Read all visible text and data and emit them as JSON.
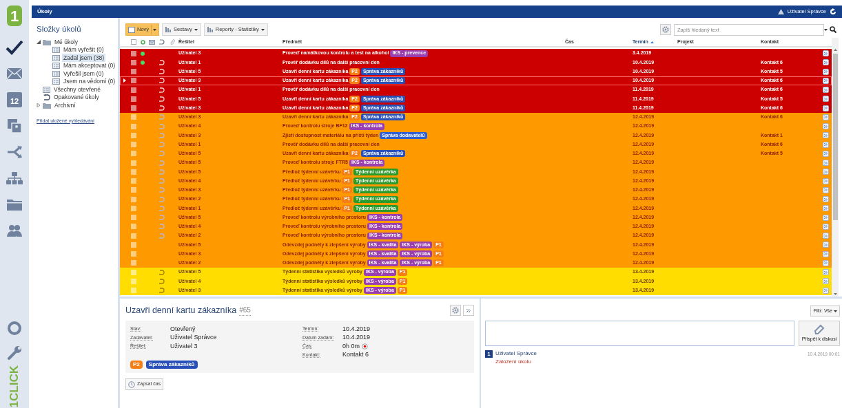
{
  "rail": {
    "logo": "1",
    "items": [
      {
        "kind": "tasks",
        "selected": true
      },
      {
        "kind": "mail",
        "selected": false
      },
      {
        "kind": "calendar",
        "text": "12",
        "selected": false
      },
      {
        "kind": "cards",
        "selected": false
      },
      {
        "kind": "share",
        "selected": false
      },
      {
        "kind": "org",
        "selected": false
      },
      {
        "kind": "folder",
        "selected": false
      },
      {
        "kind": "people",
        "selected": false
      }
    ],
    "bottom": [
      {
        "kind": "help"
      },
      {
        "kind": "wrench"
      }
    ],
    "brand": "1CLICK"
  },
  "topbar": {
    "title": "Úkoly",
    "user": "Uživatel Správce"
  },
  "folders": {
    "title": "Složky úkolů",
    "tree": [
      {
        "label": "Mé úkoly",
        "kind": "folder",
        "expanded": true,
        "selected": false,
        "children": [
          {
            "label": "Mám vyřešit (0)",
            "kind": "list",
            "selected": false
          },
          {
            "label": "Zadal jsem (38)",
            "kind": "list",
            "selected": true
          },
          {
            "label": "Mám akceptovat (0)",
            "kind": "list",
            "selected": false
          },
          {
            "label": "Vyřešil jsem (0)",
            "kind": "list",
            "selected": false
          },
          {
            "label": "Jsem na vědomí (0)",
            "kind": "list",
            "selected": false
          }
        ]
      },
      {
        "label": "Všechny otevřené",
        "kind": "list",
        "selected": false
      },
      {
        "label": "Opakované úkoly",
        "kind": "recurring",
        "selected": false
      },
      {
        "label": "Archivní",
        "kind": "folder",
        "expanded": false,
        "selected": false
      }
    ],
    "link": "Přidat uložené vyhledávání"
  },
  "toolbar": {
    "buttons": [
      {
        "label": "Nový",
        "kind": "split",
        "highlighted": true
      },
      {
        "label": "Sestavy",
        "kind": "menu",
        "highlighted": false
      },
      {
        "label": "Reporty - Statistiky",
        "kind": "menu",
        "highlighted": false
      }
    ],
    "search": {
      "placeholder": "Zapiš hledaný text"
    }
  },
  "table": {
    "all_checked": false,
    "columns": [
      {
        "label": "Řešitel",
        "sorted": false
      },
      {
        "label": "Předmět",
        "sorted": false
      },
      {
        "label": "Čas",
        "sorted": false
      },
      {
        "label": "Termín",
        "sorted": true
      },
      {
        "label": "Projekt",
        "sorted": false
      },
      {
        "label": "Kontakt",
        "sorted": false
      }
    ],
    "rows": [
      {
        "kind": "overdue",
        "selected": false,
        "checked": false,
        "unread": true,
        "recurring": false,
        "assignee": "Uživatel 3",
        "subject": "Proveď namátkovou kontrolu a test na alkohol",
        "tags": [
          {
            "text": "IKS - prevence",
            "color": "#9b3fb0"
          }
        ],
        "deadline": "3.4.2019"
      },
      {
        "kind": "overdue",
        "selected": false,
        "checked": false,
        "unread": true,
        "recurring": true,
        "assignee": "Uživatel 1",
        "subject": "Prověř dodávku dílů na další pracovní den",
        "deadline": "10.4.2019",
        "contact": "Kontakt 6"
      },
      {
        "kind": "overdue",
        "selected": false,
        "checked": false,
        "unread": false,
        "recurring": true,
        "assignee": "Uživatel 5",
        "subject": "Uzavři denní kartu zákazníka",
        "tags": [
          {
            "text": "P2",
            "color": "#f57f17"
          },
          {
            "text": "Správa zákazníků",
            "color": "#2850b8"
          }
        ],
        "deadline": "10.4.2019",
        "contact": "Kontakt 5"
      },
      {
        "kind": "overdue",
        "selected": true,
        "checked": false,
        "unread": false,
        "recurring": true,
        "assignee": "Uživatel 3",
        "subject": "Uzavři denní kartu zákazníka",
        "tags": [
          {
            "text": "P2",
            "color": "#f57f17"
          },
          {
            "text": "Správa zákazníků",
            "color": "#2850b8"
          }
        ],
        "deadline": "10.4.2019",
        "contact": "Kontakt 6"
      },
      {
        "kind": "overdue",
        "selected": false,
        "checked": false,
        "unread": false,
        "recurring": true,
        "assignee": "Uživatel 1",
        "subject": "Prověř dodávku dílů na další pracovní den",
        "deadline": "11.4.2019",
        "contact": "Kontakt 6"
      },
      {
        "kind": "overdue",
        "selected": false,
        "checked": false,
        "unread": false,
        "recurring": true,
        "assignee": "Uživatel 5",
        "subject": "Uzavři denní kartu zákazníka",
        "tags": [
          {
            "text": "P2",
            "color": "#f57f17"
          },
          {
            "text": "Správa zákazníků",
            "color": "#2850b8"
          }
        ],
        "deadline": "11.4.2019",
        "contact": "Kontakt 5"
      },
      {
        "kind": "overdue",
        "selected": false,
        "checked": false,
        "unread": false,
        "recurring": true,
        "assignee": "Uživatel 3",
        "subject": "Uzavři denní kartu zákazníka",
        "tags": [
          {
            "text": "P2",
            "color": "#f57f17"
          },
          {
            "text": "Správa zákazníků",
            "color": "#2850b8"
          }
        ],
        "deadline": "11.4.2019",
        "contact": "Kontakt 6"
      },
      {
        "kind": "due",
        "selected": false,
        "checked": false,
        "unread": false,
        "recurring": true,
        "assignee": "Uživatel 3",
        "subject": "Uzavři denní kartu zákazníka",
        "tags": [
          {
            "text": "P2",
            "color": "#f57f17"
          },
          {
            "text": "Správa zákazníků",
            "color": "#2850b8"
          }
        ],
        "deadline": "12.4.2019",
        "contact": "Kontakt 6"
      },
      {
        "kind": "due",
        "selected": false,
        "checked": false,
        "unread": false,
        "recurring": true,
        "assignee": "Uživatel 4",
        "subject": "Proveď kontrolu stroje BF12",
        "tags": [
          {
            "text": "IKS - kontrola",
            "color": "#9b3fb0"
          }
        ],
        "deadline": "12.4.2019"
      },
      {
        "kind": "due",
        "selected": false,
        "checked": false,
        "unread": false,
        "recurring": true,
        "assignee": "Uživatel 3",
        "subject": "Zjisti dostupnost materiálu na příští týden",
        "tags": [
          {
            "text": "Správa dodavatelů",
            "color": "#2f5fd0"
          }
        ],
        "deadline": "12.4.2019",
        "contact": "Kontakt 1"
      },
      {
        "kind": "due",
        "selected": false,
        "checked": false,
        "unread": false,
        "recurring": true,
        "assignee": "Uživatel 1",
        "subject": "Prověř dodávku dílů na další pracovní den",
        "deadline": "12.4.2019",
        "contact": "Kontakt 6"
      },
      {
        "kind": "due",
        "selected": false,
        "checked": false,
        "unread": false,
        "recurring": true,
        "assignee": "Uživatel 5",
        "subject": "Uzavři denní kartu zákazníka",
        "tags": [
          {
            "text": "P2",
            "color": "#f57f17"
          },
          {
            "text": "Správa zákazníků",
            "color": "#2850b8"
          }
        ],
        "deadline": "12.4.2019",
        "contact": "Kontakt 5"
      },
      {
        "kind": "due",
        "selected": false,
        "checked": false,
        "unread": false,
        "recurring": true,
        "assignee": "Uživatel 5",
        "subject": "Proveď kontrolu stroje FTR5",
        "tags": [
          {
            "text": "IKS - kontrola",
            "color": "#9b3fb0"
          }
        ],
        "deadline": "12.4.2019"
      },
      {
        "kind": "due",
        "selected": false,
        "checked": false,
        "unread": false,
        "recurring": true,
        "assignee": "Uživatel 5",
        "subject": "Předlož týdenní uzávěrku",
        "tags": [
          {
            "text": "P1",
            "color": "#f57f17"
          },
          {
            "text": "Týdenní uzávěrka",
            "color": "#2a9a2a"
          }
        ],
        "deadline": "12.4.2019"
      },
      {
        "kind": "due",
        "selected": false,
        "checked": false,
        "unread": false,
        "recurring": true,
        "assignee": "Uživatel 4",
        "subject": "Předlož týdenní uzávěrku",
        "tags": [
          {
            "text": "P1",
            "color": "#f57f17"
          },
          {
            "text": "Týdenní uzávěrka",
            "color": "#2a9a2a"
          }
        ],
        "deadline": "12.4.2019"
      },
      {
        "kind": "due",
        "selected": false,
        "checked": false,
        "unread": false,
        "recurring": true,
        "assignee": "Uživatel 3",
        "subject": "Předlož týdenní uzávěrku",
        "tags": [
          {
            "text": "P1",
            "color": "#f57f17"
          },
          {
            "text": "Týdenní uzávěrka",
            "color": "#2a9a2a"
          }
        ],
        "deadline": "12.4.2019"
      },
      {
        "kind": "due",
        "selected": false,
        "checked": false,
        "unread": false,
        "recurring": true,
        "assignee": "Uživatel 2",
        "subject": "Předlož týdenní uzávěrku",
        "tags": [
          {
            "text": "P1",
            "color": "#f57f17"
          },
          {
            "text": "Týdenní uzávěrka",
            "color": "#2a9a2a"
          }
        ],
        "deadline": "12.4.2019"
      },
      {
        "kind": "due",
        "selected": false,
        "checked": false,
        "unread": false,
        "recurring": true,
        "assignee": "Uživatel 1",
        "subject": "Předlož týdenní uzávěrku",
        "tags": [
          {
            "text": "P1",
            "color": "#f57f17"
          },
          {
            "text": "Týdenní uzávěrka",
            "color": "#2a9a2a"
          }
        ],
        "deadline": "12.4.2019"
      },
      {
        "kind": "due",
        "selected": false,
        "checked": false,
        "unread": false,
        "recurring": true,
        "assignee": "Uživatel 5",
        "subject": "Proveď kontrolu výrobního prostoru",
        "tags": [
          {
            "text": "IKS - kontrola",
            "color": "#9b3fb0"
          }
        ],
        "deadline": "12.4.2019"
      },
      {
        "kind": "due",
        "selected": false,
        "checked": false,
        "unread": false,
        "recurring": true,
        "assignee": "Uživatel 4",
        "subject": "Proveď kontrolu výrobního prostoru",
        "tags": [
          {
            "text": "IKS - kontrola",
            "color": "#9b3fb0"
          }
        ],
        "deadline": "12.4.2019"
      },
      {
        "kind": "due",
        "selected": false,
        "checked": false,
        "unread": false,
        "recurring": true,
        "assignee": "Uživatel 2",
        "subject": "Proveď kontrolu výrobního prostoru",
        "tags": [
          {
            "text": "IKS - kontrola",
            "color": "#9b3fb0"
          }
        ],
        "deadline": "12.4.2019"
      },
      {
        "kind": "due",
        "selected": false,
        "checked": false,
        "unread": false,
        "recurring": false,
        "assignee": "Uživatel 5",
        "subject": "Odevzdej podněty k zlepšení výroby",
        "tags": [
          {
            "text": "IKS - kvalita",
            "color": "#9b3fb0"
          },
          {
            "text": "IKS - výroba",
            "color": "#9b3fb0"
          },
          {
            "text": "P1",
            "color": "#f57f17"
          }
        ],
        "deadline": "12.4.2019"
      },
      {
        "kind": "due",
        "selected": false,
        "checked": false,
        "unread": false,
        "recurring": false,
        "assignee": "Uživatel 3",
        "subject": "Odevzdej podněty k zlepšení výroby",
        "tags": [
          {
            "text": "IKS - kvalita",
            "color": "#9b3fb0"
          },
          {
            "text": "IKS - výroba",
            "color": "#9b3fb0"
          },
          {
            "text": "P1",
            "color": "#f57f17"
          }
        ],
        "deadline": "12.4.2019"
      },
      {
        "kind": "due",
        "selected": false,
        "checked": false,
        "unread": false,
        "recurring": false,
        "assignee": "Uživatel 2",
        "subject": "Odevzdej podněty k zlepšení výroby",
        "tags": [
          {
            "text": "IKS - kvalita",
            "color": "#9b3fb0"
          },
          {
            "text": "IKS - výroba",
            "color": "#9b3fb0"
          },
          {
            "text": "P1",
            "color": "#f57f17"
          }
        ],
        "deadline": "12.4.2019"
      },
      {
        "kind": "upcoming",
        "selected": false,
        "checked": false,
        "unread": false,
        "recurring": true,
        "assignee": "Uživatel 5",
        "subject": "Týdenní statistika výsledků výroby",
        "tags": [
          {
            "text": "IKS - výroba",
            "color": "#9b3fb0"
          },
          {
            "text": "P1",
            "color": "#f57f17"
          }
        ],
        "deadline": "13.4.2019"
      },
      {
        "kind": "upcoming",
        "selected": false,
        "checked": false,
        "unread": false,
        "recurring": true,
        "assignee": "Uživatel 4",
        "subject": "Týdenní statistika výsledků výroby",
        "tags": [
          {
            "text": "IKS - výroba",
            "color": "#9b3fb0"
          },
          {
            "text": "P1",
            "color": "#f57f17"
          }
        ],
        "deadline": "13.4.2019"
      },
      {
        "kind": "upcoming",
        "selected": false,
        "checked": false,
        "unread": false,
        "recurring": true,
        "assignee": "Uživatel 3",
        "subject": "Týdenní statistika výsledků výroby",
        "tags": [
          {
            "text": "IKS - výroba",
            "color": "#9b3fb0"
          },
          {
            "text": "P1",
            "color": "#f57f17"
          }
        ],
        "deadline": "13.4.2019"
      }
    ]
  },
  "detail": {
    "title": "Uzavři denní kartu zákazníka",
    "number": "#65",
    "left": [
      {
        "label": "Stav:",
        "value": "Otevřený"
      },
      {
        "label": "Zadavatel:",
        "value": "Uživatel Správce"
      },
      {
        "label": "Řešitel:",
        "value": "Uživatel 3"
      }
    ],
    "right": [
      {
        "label": "Termín:",
        "value": "10.4.2019"
      },
      {
        "label": "Datum zadání:",
        "value": "10.4.2019"
      },
      {
        "label": "Čas:",
        "value": "0h 0m",
        "kind": "timer"
      },
      {
        "label": "Kontakt:",
        "value": "Kontakt 6"
      }
    ],
    "tags": [
      {
        "text": "P2",
        "color": "#f57f17"
      },
      {
        "text": "Správa zákazníků",
        "color": "#2850b8"
      }
    ],
    "log_button": "Zapsat čas"
  },
  "discussion": {
    "filter": "Filtr: Vše",
    "post_button": "Přispět k diskusi",
    "entries": [
      {
        "number": "1",
        "author": "Uživatel Správce",
        "text": "Založení úkolu",
        "time": "10.4.2019 00:01"
      }
    ]
  }
}
